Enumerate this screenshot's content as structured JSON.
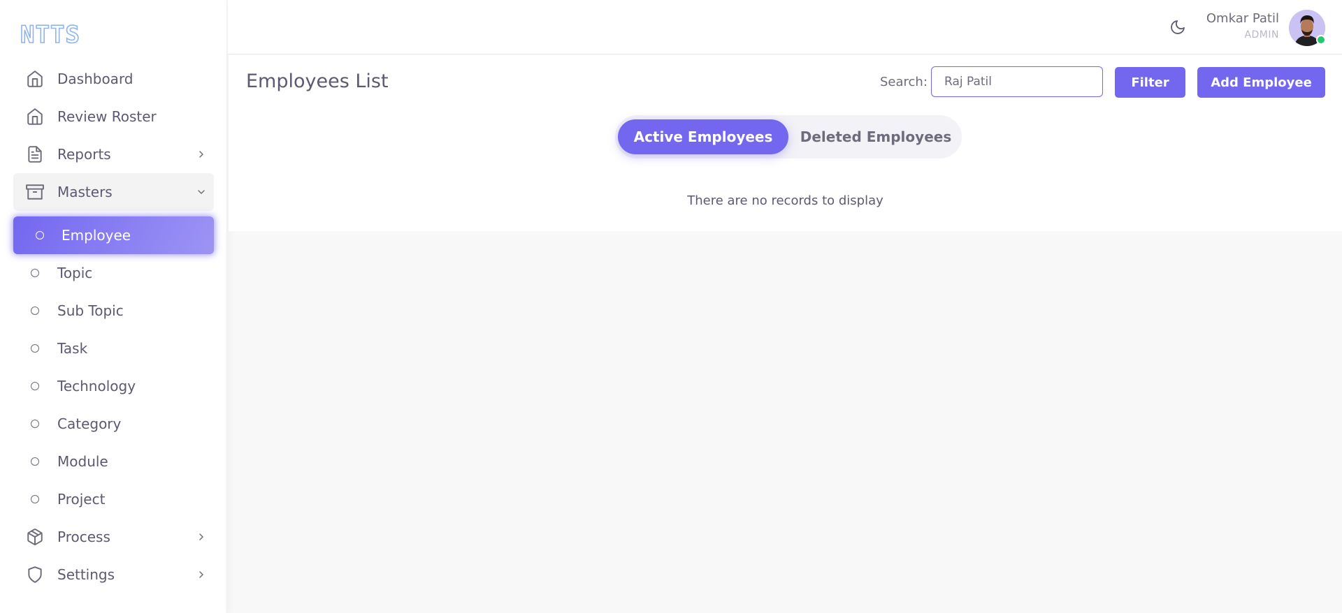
{
  "brand": {
    "name": "NTTS"
  },
  "sidebar": {
    "items": [
      {
        "label": "Dashboard",
        "icon": "home-icon"
      },
      {
        "label": "Review Roster",
        "icon": "home-icon"
      },
      {
        "label": "Reports",
        "icon": "file-text-icon",
        "has_children": true
      },
      {
        "label": "Masters",
        "icon": "archive-icon",
        "has_children": true,
        "expanded": true
      },
      {
        "label": "Process",
        "icon": "box-icon",
        "has_children": true
      },
      {
        "label": "Settings",
        "icon": "shield-icon",
        "has_children": true
      }
    ],
    "masters_children": [
      {
        "label": "Employee",
        "active": true
      },
      {
        "label": "Topic"
      },
      {
        "label": "Sub Topic"
      },
      {
        "label": "Task"
      },
      {
        "label": "Technology"
      },
      {
        "label": "Category"
      },
      {
        "label": "Module"
      },
      {
        "label": "Project"
      }
    ]
  },
  "navbar": {
    "user_name": "Omkar Patil",
    "user_role": "ADMIN",
    "theme_icon": "moon-icon",
    "status": "online"
  },
  "main": {
    "title": "Employees List",
    "search": {
      "label": "Search:",
      "value": "Raj Patil"
    },
    "filter_label": "Filter",
    "add_label": "Add Employee",
    "tabs": [
      {
        "label": "Active Employees",
        "active": true
      },
      {
        "label": "Deleted Employees",
        "active": false
      }
    ],
    "empty_message": "There are no records to display"
  },
  "colors": {
    "primary": "#7367f0",
    "text": "#5e5873",
    "success": "#28c76f",
    "background": "#f8f8f8"
  }
}
